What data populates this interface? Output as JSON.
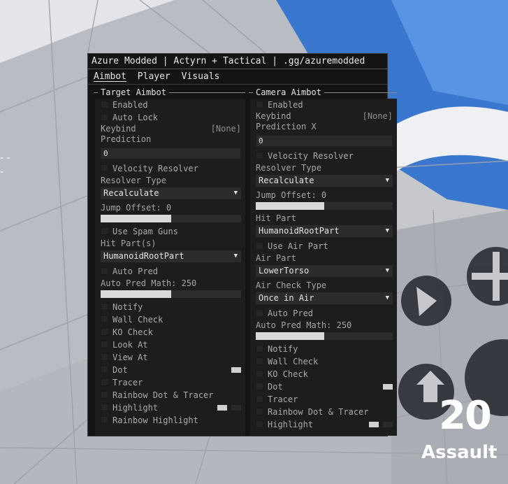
{
  "hud": {
    "round_number": "20",
    "mode_label": "Assault",
    "dash_marks": "- -\n-"
  },
  "menu": {
    "title": "Azure Modded | Actyrn + Tactical | .gg/azuremodded",
    "tabs": [
      {
        "label": "Aimbot",
        "active": true
      },
      {
        "label": "Player"
      },
      {
        "label": "Visuals"
      }
    ],
    "left": {
      "header": "Target Aimbot",
      "enabled": "Enabled",
      "auto_lock": "Auto Lock",
      "keybind_label": "Keybind",
      "keybind_value": "[None]",
      "prediction_label": "Prediction",
      "prediction_value": "0",
      "velocity_resolver": "Velocity Resolver",
      "resolver_type_label": "Resolver Type",
      "resolver_type_value": "Recalculate",
      "jump_offset_label": "Jump Offset: 0",
      "jump_offset_fill": 0.5,
      "use_spam_guns": "Use Spam Guns",
      "hit_parts_label": "Hit Part(s)",
      "hit_parts_value": "HumanoidRootPart",
      "auto_pred": "Auto Pred",
      "auto_pred_math_label": "Auto Pred Math: 250",
      "auto_pred_math_fill": 0.5,
      "notify": "Notify",
      "wall_check": "Wall Check",
      "ko_check": "KO Check",
      "look_at": "Look At",
      "view_at": "View At",
      "dot": "Dot",
      "tracer": "Tracer",
      "rainbow_dot_tracer": "Rainbow Dot & Tracer",
      "highlight": "Highlight",
      "rainbow_highlight": "Rainbow Highlight"
    },
    "right": {
      "header": "Camera Aimbot",
      "enabled": "Enabled",
      "keybind_label": "Keybind",
      "keybind_value": "[None]",
      "prediction_label": "Prediction X",
      "prediction_value": "0",
      "velocity_resolver": "Velocity Resolver",
      "resolver_type_label": "Resolver Type",
      "resolver_type_value": "Recalculate",
      "jump_offset_label": "Jump Offset: 0",
      "jump_offset_fill": 0.5,
      "hit_part_label": "Hit Part",
      "hit_part_value": "HumanoidRootPart",
      "use_air_part": "Use Air Part",
      "air_part_label": "Air Part",
      "air_part_value": "LowerTorso",
      "air_check_type_label": "Air Check Type",
      "air_check_type_value": "Once in Air",
      "auto_pred": "Auto Pred",
      "auto_pred_math_label": "Auto Pred Math: 250",
      "auto_pred_math_fill": 0.5,
      "notify": "Notify",
      "wall_check": "Wall Check",
      "ko_check": "KO Check",
      "dot": "Dot",
      "tracer": "Tracer",
      "rainbow_dot_tracer": "Rainbow Dot & Tracer",
      "highlight": "Highlight"
    }
  }
}
